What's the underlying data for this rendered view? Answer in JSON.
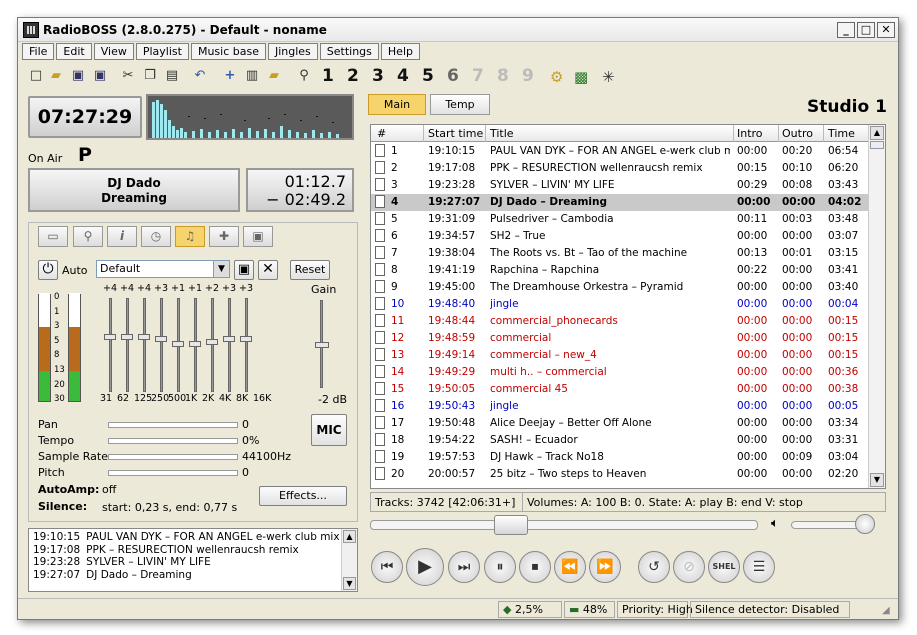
{
  "window": {
    "title": "RadioBOSS (2.8.0.275) - Default - noname"
  },
  "menu": [
    "File",
    "Edit",
    "View",
    "Playlist",
    "Music base",
    "Jingles",
    "Settings",
    "Help"
  ],
  "toolbar": {
    "numbers": [
      "1",
      "2",
      "3",
      "4",
      "5",
      "6",
      "7",
      "8",
      "9"
    ]
  },
  "clock": "07:27:29 P",
  "on_air_label": "On Air",
  "now_playing": {
    "artist": "DJ Dado",
    "title": "Dreaming",
    "elapsed": "01:12.7",
    "remaining": "− 02:49.2"
  },
  "effects_panel": {
    "auto_label": "Auto",
    "preset": "Default",
    "reset_label": "Reset",
    "gain_label": "Gain",
    "gain_value": "-2 dB",
    "eq_values": [
      "+4",
      "+4",
      "+4",
      "+3",
      "+1",
      "+1",
      "+2",
      "+3",
      "+3"
    ],
    "eq_levels": [
      4,
      4,
      4,
      3,
      1,
      1,
      2,
      3,
      3
    ],
    "eq_freqs": [
      "31",
      "62",
      "125",
      "250",
      "500",
      "1K",
      "2K",
      "4K",
      "8K",
      "16K"
    ],
    "meter_scale": [
      "0",
      "1",
      "3",
      "5",
      "8",
      "13",
      "20",
      "30"
    ],
    "pan_label": "Pan",
    "pan_value": "0",
    "tempo_label": "Tempo",
    "tempo_value": "0%",
    "sample_rate_label": "Sample Rate",
    "sample_rate_value": "44100Hz",
    "pitch_label": "Pitch",
    "pitch_value": "0",
    "mic_label": "MIC",
    "autoamp_label": "AutoAmp:",
    "autoamp_value": "off",
    "silence_label": "Silence:",
    "silence_value": "start: 0,23 s,  end: 0,77 s",
    "effects_label": "Effects..."
  },
  "history": [
    {
      "time": "19:10:15",
      "track": "PAUL VAN DYK – FOR AN ANGEL e-werk club mix"
    },
    {
      "time": "19:17:08",
      "track": "PPK – RESURECTION wellenraucsh remix"
    },
    {
      "time": "19:23:28",
      "track": "SYLVER – LIVIN' MY LIFE"
    },
    {
      "time": "19:27:07",
      "track": "DJ Dado – Dreaming"
    }
  ],
  "tabs": {
    "main": "Main",
    "temp": "Temp"
  },
  "studio": "Studio 1",
  "columns": {
    "num": "#",
    "start": "Start time",
    "title": "Title",
    "intro": "Intro",
    "outro": "Outro",
    "time": "Time"
  },
  "colors": {
    "normal": "#000000",
    "jingle": "#0000c0",
    "commercial": "#c00000",
    "current_row": "#c9c9c9"
  },
  "playlist": [
    {
      "n": "1",
      "start": "19:10:15",
      "title": "PAUL VAN DYK – FOR AN ANGEL e-werk club mix",
      "intro": "00:00",
      "outro": "00:20",
      "time": "06:54",
      "kind": "normal"
    },
    {
      "n": "2",
      "start": "19:17:08",
      "title": "PPK – RESURECTION wellenraucsh remix",
      "intro": "00:15",
      "outro": "00:10",
      "time": "06:20",
      "kind": "normal"
    },
    {
      "n": "3",
      "start": "19:23:28",
      "title": "SYLVER – LIVIN' MY LIFE",
      "intro": "00:29",
      "outro": "00:08",
      "time": "03:43",
      "kind": "normal"
    },
    {
      "n": "4",
      "start": "19:27:07",
      "title": "DJ Dado – Dreaming",
      "intro": "00:00",
      "outro": "00:00",
      "time": "04:02",
      "kind": "current"
    },
    {
      "n": "5",
      "start": "19:31:09",
      "title": "Pulsedriver – Cambodia",
      "intro": "00:11",
      "outro": "00:03",
      "time": "03:48",
      "kind": "normal"
    },
    {
      "n": "6",
      "start": "19:34:57",
      "title": "SH2 – True",
      "intro": "00:00",
      "outro": "00:00",
      "time": "03:07",
      "kind": "normal"
    },
    {
      "n": "7",
      "start": "19:38:04",
      "title": "The Roots vs. Bt – Tao of the machine",
      "intro": "00:13",
      "outro": "00:01",
      "time": "03:15",
      "kind": "normal"
    },
    {
      "n": "8",
      "start": "19:41:19",
      "title": "Rapchina – Rapchina",
      "intro": "00:22",
      "outro": "00:00",
      "time": "03:41",
      "kind": "normal"
    },
    {
      "n": "9",
      "start": "19:45:00",
      "title": "The Dreamhouse Orkestra – Pyramid",
      "intro": "00:00",
      "outro": "00:00",
      "time": "03:40",
      "kind": "normal"
    },
    {
      "n": "10",
      "start": "19:48:40",
      "title": "jingle",
      "intro": "00:00",
      "outro": "00:00",
      "time": "00:04",
      "kind": "jingle"
    },
    {
      "n": "11",
      "start": "19:48:44",
      "title": "commercial_phonecards",
      "intro": "00:00",
      "outro": "00:00",
      "time": "00:15",
      "kind": "commercial"
    },
    {
      "n": "12",
      "start": "19:48:59",
      "title": "commercial",
      "intro": "00:00",
      "outro": "00:00",
      "time": "00:15",
      "kind": "commercial"
    },
    {
      "n": "13",
      "start": "19:49:14",
      "title": "commercial – new_4",
      "intro": "00:00",
      "outro": "00:00",
      "time": "00:15",
      "kind": "commercial"
    },
    {
      "n": "14",
      "start": "19:49:29",
      "title": "multi h.. – commercial",
      "intro": "00:00",
      "outro": "00:00",
      "time": "00:36",
      "kind": "commercial"
    },
    {
      "n": "15",
      "start": "19:50:05",
      "title": "commercial 45",
      "intro": "00:00",
      "outro": "00:00",
      "time": "00:38",
      "kind": "commercial"
    },
    {
      "n": "16",
      "start": "19:50:43",
      "title": "jingle",
      "intro": "00:00",
      "outro": "00:00",
      "time": "00:05",
      "kind": "jingle"
    },
    {
      "n": "17",
      "start": "19:50:48",
      "title": "Alice Deejay – Better Off Alone",
      "intro": "00:00",
      "outro": "00:00",
      "time": "03:34",
      "kind": "normal"
    },
    {
      "n": "18",
      "start": "19:54:22",
      "title": "SASH! – Ecuador",
      "intro": "00:00",
      "outro": "00:00",
      "time": "03:31",
      "kind": "normal"
    },
    {
      "n": "19",
      "start": "19:57:53",
      "title": "DJ Hawk – Track No18",
      "intro": "00:00",
      "outro": "00:09",
      "time": "03:04",
      "kind": "normal"
    },
    {
      "n": "20",
      "start": "20:00:57",
      "title": "25 bitz – Two steps to Heaven",
      "intro": "00:00",
      "outro": "00:00",
      "time": "02:20",
      "kind": "normal"
    }
  ],
  "tracks_info": "Tracks: 3742 [42:06:31+]",
  "volumes_info": "Volumes: A: 100 B: 0. State: A: play B: end V: stop",
  "playback_position": 0.35,
  "volume_level": 1.0,
  "status": {
    "cpu": "2,5%",
    "memory": "48%",
    "priority": "Priority: High",
    "silence": "Silence detector: Disabled"
  }
}
